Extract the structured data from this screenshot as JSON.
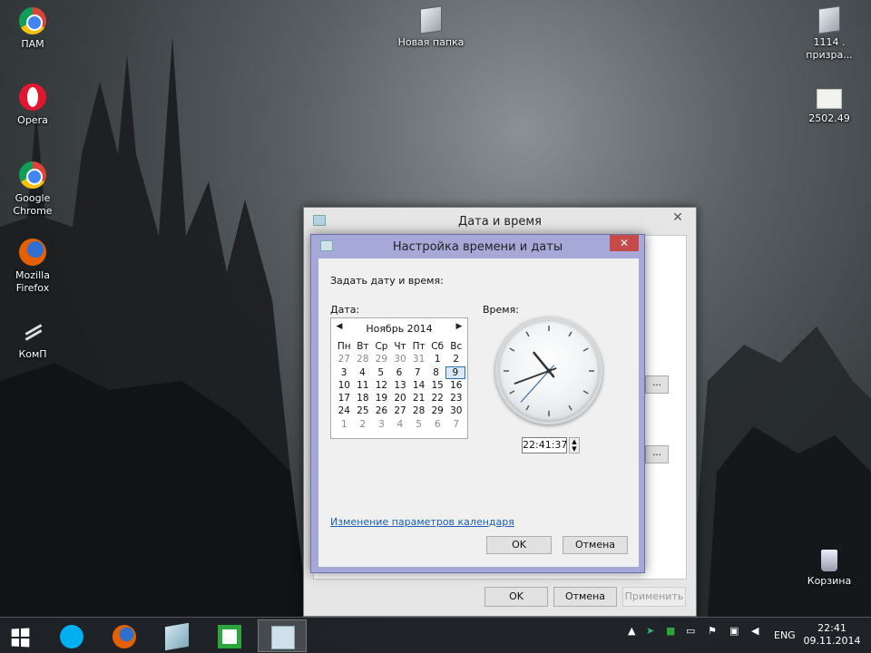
{
  "desktop": {
    "icons_left": [
      {
        "label": "ПАМ",
        "icon": "chrome-icon"
      },
      {
        "label": "Opera",
        "icon": "opera-icon"
      },
      {
        "label": "Google Chrome",
        "icon": "chrome-icon"
      },
      {
        "label": "Mozilla Firefox",
        "icon": "firefox-icon"
      },
      {
        "label": "КомП",
        "icon": "shortcut-icon"
      }
    ],
    "folder_new": "Новая папка",
    "icon_right_1": "1114 . призра...",
    "icon_right_2": "2502.49",
    "recycle_bin": "Корзина"
  },
  "parent_window": {
    "title": "Дата и время",
    "ok": "OK",
    "cancel": "Отмена",
    "apply": "Применить",
    "side_button": "..."
  },
  "dialog": {
    "title": "Настройка времени и даты",
    "close": "✕",
    "prompt": "Задать дату и время:",
    "date_label": "Дата:",
    "time_label": "Время:",
    "month": "Ноябрь 2014",
    "weekdays": [
      "Пн",
      "Вт",
      "Ср",
      "Чт",
      "Пт",
      "Сб",
      "Вс"
    ],
    "weeks": [
      [
        "27",
        "28",
        "29",
        "30",
        "31",
        "1",
        "2"
      ],
      [
        "3",
        "4",
        "5",
        "6",
        "7",
        "8",
        "9"
      ],
      [
        "10",
        "11",
        "12",
        "13",
        "14",
        "15",
        "16"
      ],
      [
        "17",
        "18",
        "19",
        "20",
        "21",
        "22",
        "23"
      ],
      [
        "24",
        "25",
        "26",
        "27",
        "28",
        "29",
        "30"
      ],
      [
        "1",
        "2",
        "3",
        "4",
        "5",
        "6",
        "7"
      ]
    ],
    "selected_day": "9",
    "time_value": "22:41:37",
    "clock": {
      "hour": 22,
      "minute": 41,
      "second": 37
    },
    "calendar_link": "Изменение параметров календаря",
    "ok": "OK",
    "cancel": "Отмена"
  },
  "taskbar": {
    "language": "ENG",
    "time": "22:41",
    "date": "09.11.2014"
  },
  "colors": {
    "dialog_frame": "#a6a8d8",
    "close_red": "#c74a4a",
    "link_blue": "#1a5fb4"
  }
}
